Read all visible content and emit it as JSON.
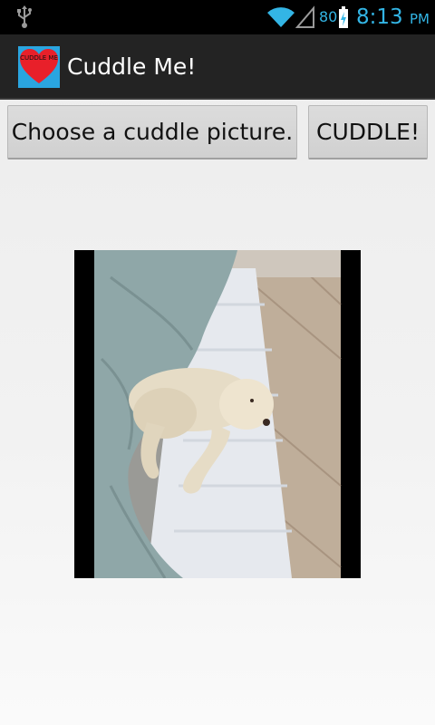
{
  "status_bar": {
    "battery_percent": "80",
    "time": "8:13",
    "ampm": "PM",
    "icons": [
      "usb-icon",
      "wifi-icon",
      "signal-icon",
      "battery-charging-icon"
    ],
    "accent_color": "#33b5e5"
  },
  "action_bar": {
    "title": "Cuddle Me!",
    "app_icon_text": "CUDDLE ME",
    "app_icon_colors": {
      "background": "#2aa5e0",
      "heart": "#e8202a"
    }
  },
  "buttons": {
    "choose_label": "Choose a cuddle picture.",
    "cuddle_label": "CUDDLE!"
  },
  "picture": {
    "subject": "photo-image"
  }
}
